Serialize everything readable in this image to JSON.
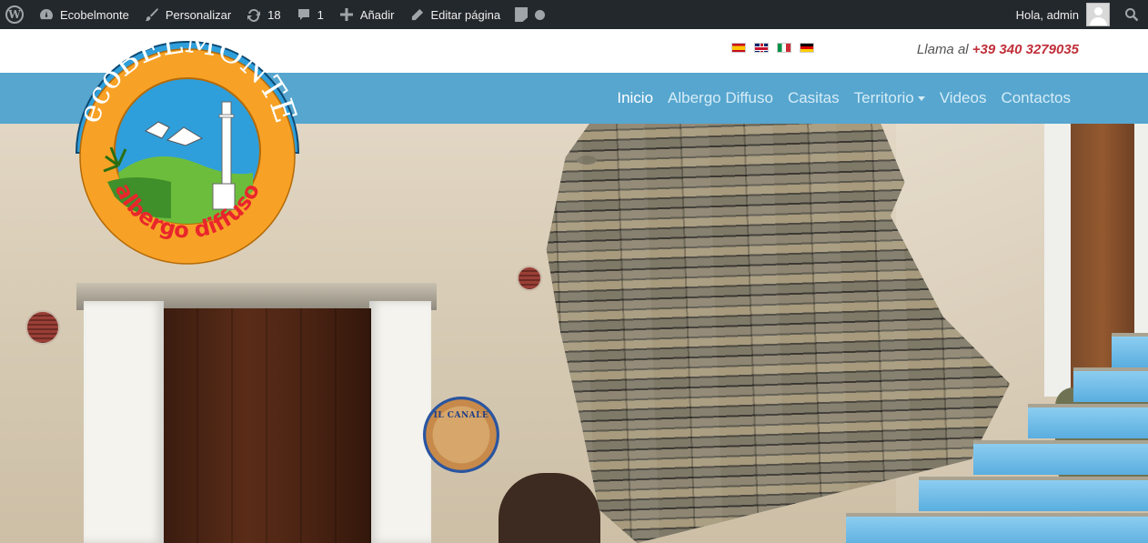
{
  "adminbar": {
    "site_name": "Ecobelmonte",
    "customize": "Personalizar",
    "updates": "18",
    "comments": "1",
    "add_new": "Añadir",
    "edit_page": "Editar página",
    "greeting": "Hola, admin"
  },
  "topbar": {
    "flags": [
      "es",
      "gb",
      "it",
      "de"
    ],
    "phone_prefix": "Llama al",
    "phone_number": "+39 340 3279035"
  },
  "nav": {
    "items": [
      {
        "label": "Inicio",
        "active": true
      },
      {
        "label": "Albergo Diffuso"
      },
      {
        "label": "Casitas"
      },
      {
        "label": "Territorio",
        "dropdown": true
      },
      {
        "label": "Videos"
      },
      {
        "label": "Contactos"
      }
    ]
  },
  "logo": {
    "top_text": "ecoBELMONTE",
    "bottom_text": "albergo diffuso"
  },
  "hero": {
    "plaque_text": "IL CANALE"
  },
  "colors": {
    "adminbar_bg": "#23282d",
    "navbar_bg": "#56a6cf",
    "phone_accent": "#c0303a",
    "logo_orange": "#f7a226",
    "logo_blue": "#2f9fdb"
  }
}
